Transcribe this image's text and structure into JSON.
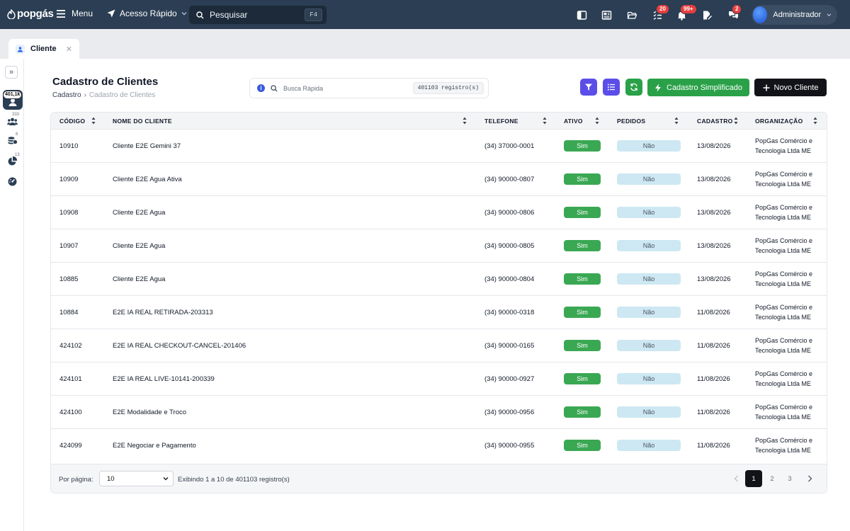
{
  "topbar": {
    "logo": "popgás",
    "menu_label": "Menu",
    "quick_access_label": "Acesso Rápido",
    "search_placeholder": "Pesquisar",
    "search_shortcut": "F4",
    "tasks_badge": "20",
    "notifications_badge": "99+",
    "messages_badge": "2",
    "user_name": "Administrador",
    "background_color": "#2b3e54"
  },
  "tabs": [
    {
      "label": "Cliente"
    }
  ],
  "rail": {
    "active_badge": "401,1k",
    "counts": [
      "333",
      "8",
      "13"
    ]
  },
  "page": {
    "title": "Cadastro de Clientes",
    "breadcrumb": [
      "Cadastro",
      "Cadastro de Clientes"
    ],
    "breadcrumb_separator": "›",
    "quick_search_placeholder": "Busca Rápida",
    "records_pill": "401103 registro(s)",
    "simplified_button": "Cadastro Simplificado",
    "new_button": "Novo Cliente",
    "accent_purple": "#5b4ee8",
    "accent_green": "#2aa148"
  },
  "table": {
    "columns": [
      "CÓDIGO",
      "NOME DO CLIENTE",
      "TELEFONE",
      "ATIVO",
      "PEDIDOS",
      "CADASTRO",
      "ORGANIZAÇÃO"
    ],
    "rows": [
      {
        "code": "10910",
        "name": "Cliente E2E Gemini 37",
        "phone": "(34) 37000-0001",
        "active": "Sim",
        "orders": "Não",
        "date": "13/08/2026",
        "org1": "PopGas Comércio e",
        "org2": "Tecnologia Ltda ME"
      },
      {
        "code": "10909",
        "name": "Cliente E2E Agua Ativa",
        "phone": "(34) 90000-0807",
        "active": "Sim",
        "orders": "Não",
        "date": "13/08/2026",
        "org1": "PopGas Comércio e",
        "org2": "Tecnologia Ltda ME"
      },
      {
        "code": "10908",
        "name": "Cliente E2E Agua",
        "phone": "(34) 90000-0806",
        "active": "Sim",
        "orders": "Não",
        "date": "13/08/2026",
        "org1": "PopGas Comércio e",
        "org2": "Tecnologia Ltda ME"
      },
      {
        "code": "10907",
        "name": "Cliente E2E Agua",
        "phone": "(34) 90000-0805",
        "active": "Sim",
        "orders": "Não",
        "date": "13/08/2026",
        "org1": "PopGas Comércio e",
        "org2": "Tecnologia Ltda ME"
      },
      {
        "code": "10885",
        "name": "Cliente E2E Agua",
        "phone": "(34) 90000-0804",
        "active": "Sim",
        "orders": "Não",
        "date": "13/08/2026",
        "org1": "PopGas Comércio e",
        "org2": "Tecnologia Ltda ME"
      },
      {
        "code": "10884",
        "name": "E2E IA REAL RETIRADA-203313",
        "phone": "(34) 90000-0318",
        "active": "Sim",
        "orders": "Não",
        "date": "11/08/2026",
        "org1": "PopGas Comércio e",
        "org2": "Tecnologia Ltda ME"
      },
      {
        "code": "424102",
        "name": "E2E IA REAL CHECKOUT-CANCEL-201406",
        "phone": "(34) 90000-0165",
        "active": "Sim",
        "orders": "Não",
        "date": "11/08/2026",
        "org1": "PopGas Comércio e",
        "org2": "Tecnologia Ltda ME"
      },
      {
        "code": "424101",
        "name": "E2E IA REAL LIVE-10141-200339",
        "phone": "(34) 90000-0927",
        "active": "Sim",
        "orders": "Não",
        "date": "11/08/2026",
        "org1": "PopGas Comércio e",
        "org2": "Tecnologia Ltda ME"
      },
      {
        "code": "424100",
        "name": "E2E Modalidade e Troco",
        "phone": "(34) 90000-0956",
        "active": "Sim",
        "orders": "Não",
        "date": "11/08/2026",
        "org1": "PopGas Comércio e",
        "org2": "Tecnologia Ltda ME"
      },
      {
        "code": "424099",
        "name": "E2E Negociar e Pagamento",
        "phone": "(34) 90000-0955",
        "active": "Sim",
        "orders": "Não",
        "date": "11/08/2026",
        "org1": "PopGas Comércio e",
        "org2": "Tecnologia Ltda ME"
      }
    ]
  },
  "footer": {
    "per_page_label": "Por página:",
    "per_page_value": "10",
    "showing_text": "Exibindo 1 a 10 de 401103 registro(s)",
    "pages": [
      "1",
      "2",
      "3"
    ],
    "current_page": "1"
  }
}
